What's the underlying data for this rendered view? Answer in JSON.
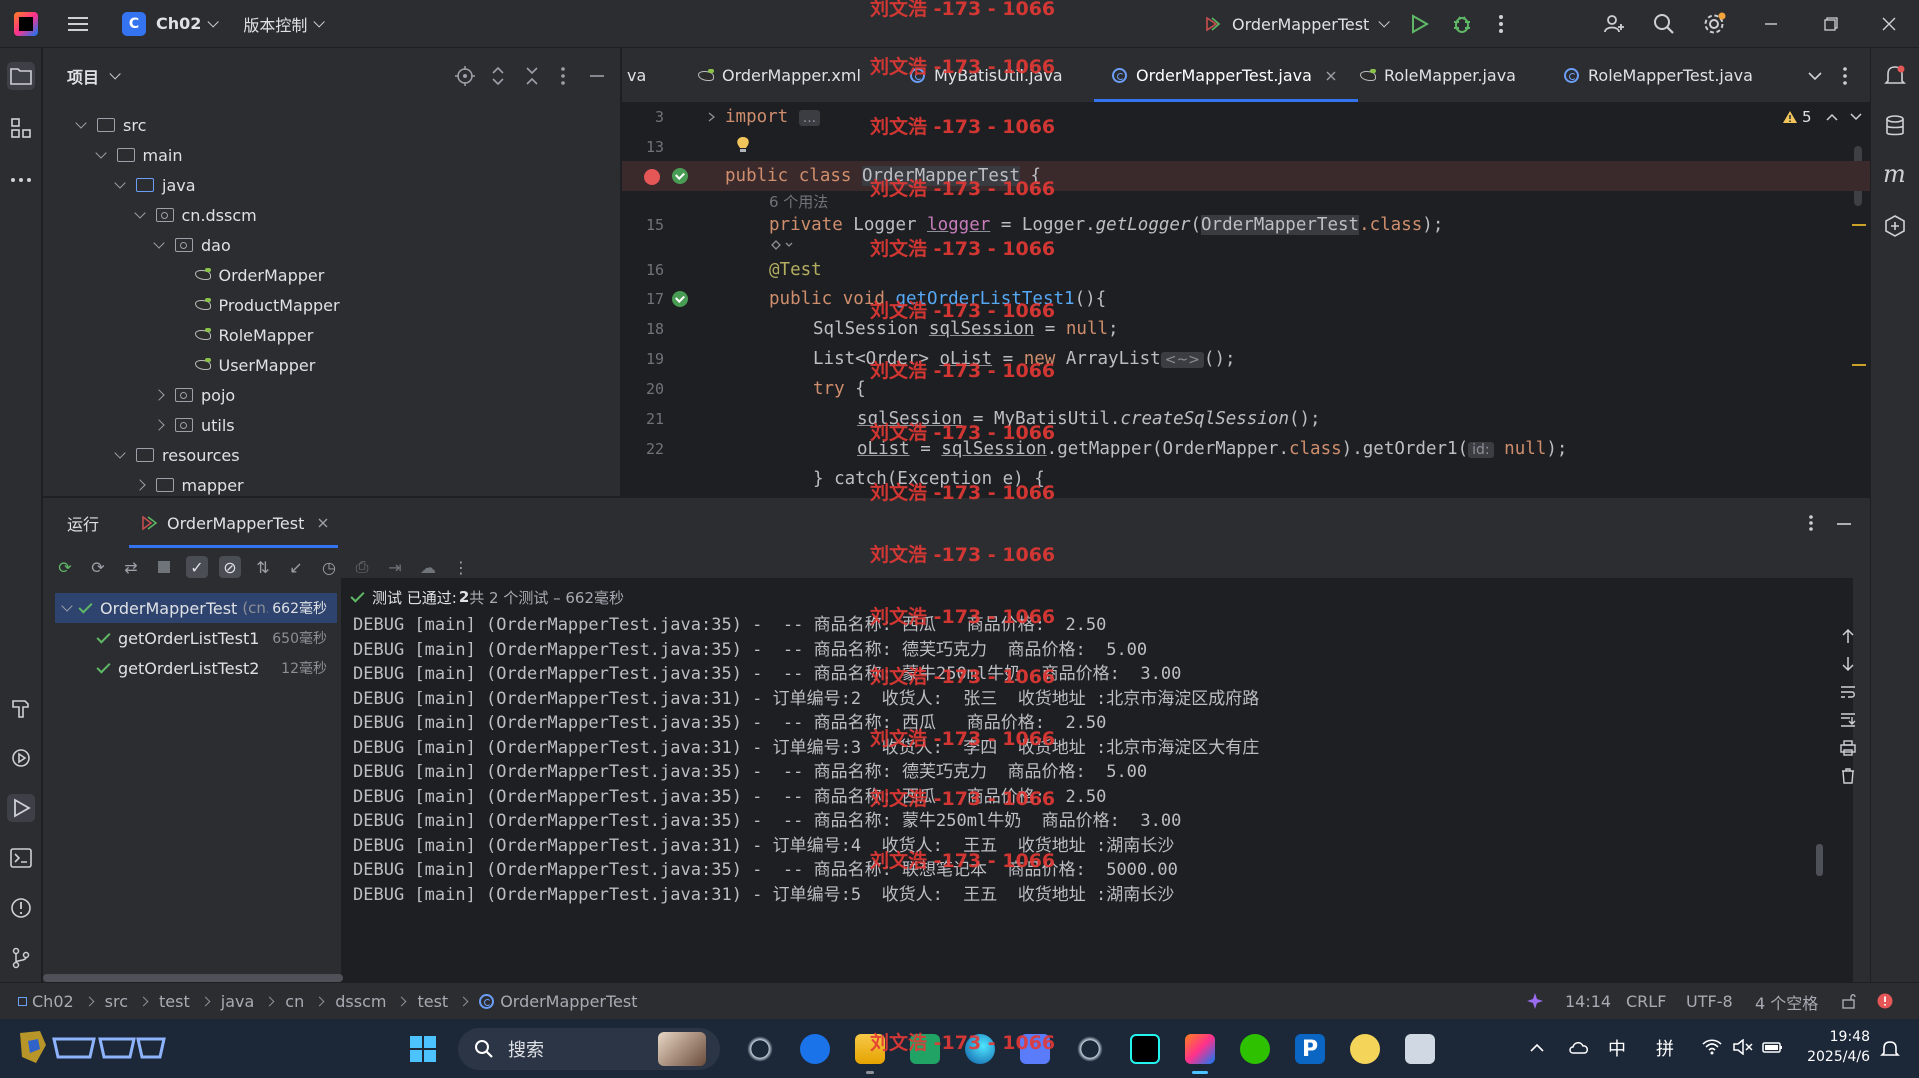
{
  "titlebar": {
    "project_badge": "C",
    "project_name": "Ch02",
    "vcs_label": "版本控制",
    "run_config": "OrderMapperTest"
  },
  "project_panel": {
    "title": "项目",
    "tree": [
      {
        "label": "src",
        "indent": 0,
        "kind": "folder",
        "state": "open"
      },
      {
        "label": "main",
        "indent": 1,
        "kind": "folder",
        "state": "open"
      },
      {
        "label": "java",
        "indent": 2,
        "kind": "folder-blue",
        "state": "open"
      },
      {
        "label": "cn.dsscm",
        "indent": 3,
        "kind": "package",
        "state": "open"
      },
      {
        "label": "dao",
        "indent": 4,
        "kind": "package",
        "state": "open"
      },
      {
        "label": "OrderMapper",
        "indent": 5,
        "kind": "mybatis",
        "state": "leaf"
      },
      {
        "label": "ProductMapper",
        "indent": 5,
        "kind": "mybatis",
        "state": "leaf"
      },
      {
        "label": "RoleMapper",
        "indent": 5,
        "kind": "mybatis",
        "state": "leaf"
      },
      {
        "label": "UserMapper",
        "indent": 5,
        "kind": "mybatis",
        "state": "leaf"
      },
      {
        "label": "pojo",
        "indent": 4,
        "kind": "package",
        "state": "closed"
      },
      {
        "label": "utils",
        "indent": 4,
        "kind": "package",
        "state": "closed"
      },
      {
        "label": "resources",
        "indent": 2,
        "kind": "folder",
        "state": "open"
      },
      {
        "label": "mapper",
        "indent": 3,
        "kind": "folder",
        "state": "closed"
      }
    ]
  },
  "editor": {
    "tabs": [
      {
        "label": "va",
        "icon": "none",
        "active": false
      },
      {
        "label": "OrderMapper.xml",
        "icon": "mybatis-icon",
        "active": false
      },
      {
        "label": "MyBatisUtil.java",
        "icon": "class-icon",
        "active": false
      },
      {
        "label": "OrderMapperTest.java",
        "icon": "class-icon",
        "active": true
      },
      {
        "label": "RoleMapper.java",
        "icon": "mybatis-icon",
        "active": false
      },
      {
        "label": "RoleMapperTest.java",
        "icon": "class-icon",
        "active": false
      }
    ],
    "warnings": "5",
    "lines": {
      "n3": "3",
      "n13": "13",
      "n15": "15",
      "n16": "16",
      "n17": "17",
      "n18": "18",
      "n19": "19",
      "n20": "20",
      "n21": "21",
      "n22": "22",
      "usages": "6 个用法",
      "import_kw": "import",
      "import_fold": "...",
      "l14_a": "public class ",
      "l14_b": "OrderMapperTest",
      "l14_c": " {",
      "l15_a": "private ",
      "l15_b": "Logger ",
      "l15_c": "logger",
      "l15_d": " = Logger.",
      "l15_e": "getLogger",
      "l15_f": "(",
      "l15_g": "OrderMapperTest",
      "l15_h": ".class",
      "l15_i": ");",
      "l16": "@Test",
      "l17_a": "public void ",
      "l17_b": "getOrderListTest1",
      "l17_c": "(){",
      "l18_a": "SqlSession ",
      "l18_b": "sqlSession",
      "l18_c": " = ",
      "l18_d": "null",
      "l18_e": ";",
      "l19_a": "List<Order> ",
      "l19_b": "oList",
      "l19_c": " = ",
      "l19_d": "new ",
      "l19_e": "ArrayList",
      "l19_f": "<~>",
      "l19_g": "();",
      "l20_a": "try",
      "l20_b": " {",
      "l21_a": "sqlSession",
      "l21_b": " = MyBatisUtil.",
      "l21_c": "createSqlSession",
      "l21_d": "();",
      "l22_a": "oList",
      "l22_b": " = ",
      "l22_c": "sqlSession",
      "l22_d": ".getMapper(OrderMapper.",
      "l22_e": "class",
      "l22_f": ").getOrder1(",
      "l22_g": "id:",
      "l22_h": "null",
      "l22_i": ");",
      "l23": "} catch(Exception e) {"
    }
  },
  "run_panel": {
    "title": "运行",
    "tab": "OrderMapperTest",
    "status_prefix": "测试 已通过:",
    "status_count": "2",
    "status_suffix": "共 2 个测试 – 662毫秒",
    "tests": [
      {
        "name": "OrderMapperTest",
        "pkg": "(cn.dsscm",
        "duration": "662毫秒",
        "root": true
      },
      {
        "name": "getOrderListTest1",
        "pkg": "",
        "duration": "650毫秒",
        "root": false
      },
      {
        "name": "getOrderListTest2",
        "pkg": "",
        "duration": "12毫秒",
        "root": false
      }
    ],
    "console": [
      "DEBUG [main] (OrderMapperTest.java:35) -  -- 商品名称: 西瓜   商品价格:  2.50",
      "DEBUG [main] (OrderMapperTest.java:35) -  -- 商品名称: 德芙巧克力  商品价格:  5.00",
      "DEBUG [main] (OrderMapperTest.java:35) -  -- 商品名称: 蒙牛250ml牛奶  商品价格:  3.00",
      "DEBUG [main] (OrderMapperTest.java:31) - 订单编号:2  收货人:  张三  收货地址 :北京市海淀区成府路",
      "DEBUG [main] (OrderMapperTest.java:35) -  -- 商品名称: 西瓜   商品价格:  2.50",
      "DEBUG [main] (OrderMapperTest.java:31) - 订单编号:3  收货人:  李四  收货地址 :北京市海淀区大有庄",
      "DEBUG [main] (OrderMapperTest.java:35) -  -- 商品名称: 德芙巧克力  商品价格:  5.00",
      "DEBUG [main] (OrderMapperTest.java:35) -  -- 商品名称: 西瓜   商品价格:  2.50",
      "DEBUG [main] (OrderMapperTest.java:35) -  -- 商品名称: 蒙牛250ml牛奶  商品价格:  3.00",
      "DEBUG [main] (OrderMapperTest.java:31) - 订单编号:4  收货人:  王五  收货地址 :湖南长沙",
      "DEBUG [main] (OrderMapperTest.java:35) -  -- 商品名称: 联想笔记本  商品价格:  5000.00",
      "DEBUG [main] (OrderMapperTest.java:31) - 订单编号:5  收货人:  王五  收货地址 :湖南长沙"
    ]
  },
  "statusbar": {
    "breadcrumbs": [
      "Ch02",
      "src",
      "test",
      "java",
      "cn",
      "dsscm",
      "test",
      "OrderMapperTest"
    ],
    "position": "14:14",
    "line_sep": "CRLF",
    "encoding": "UTF-8",
    "indent": "4 个空格"
  },
  "taskbar": {
    "search_placeholder": "搜索",
    "ime_lang": "中",
    "ime_mode": "拼",
    "time": "19:48",
    "date": "2025/4/6"
  },
  "watermark": "刘文浩 -173 - 1066",
  "colors": {
    "accent": "#3574f0",
    "pass": "#5fb865",
    "watermark": "#e53935",
    "breakpoint": "#e55757"
  }
}
